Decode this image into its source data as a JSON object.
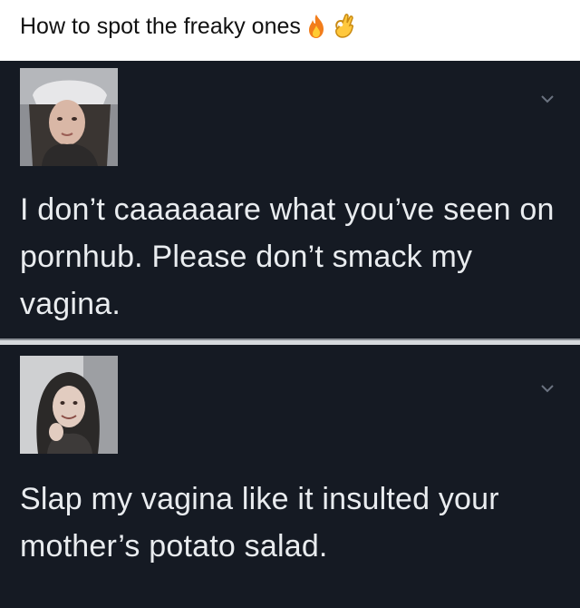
{
  "post": {
    "caption": "How to spot the freaky ones",
    "caption_emojis": [
      "fire-emoji",
      "ok-hand-emoji"
    ]
  },
  "screenshot": {
    "background": "#151a23",
    "text_color": "#e9ecef",
    "tweets": [
      {
        "avatar": "profile-photo-woman-in-hat",
        "text": "I don’t caaaaaare what you’ve seen on pornhub.  Please don’t smack my vagina."
      },
      {
        "avatar": "profile-photo-woman-smiling",
        "text": "Slap my vagina like it insulted your mother’s potato salad."
      }
    ]
  }
}
